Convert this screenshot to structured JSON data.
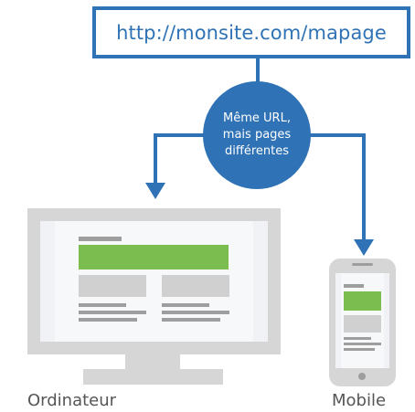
{
  "url": "http://monsite.com/mapage",
  "bubble": {
    "lines": [
      "Même URL,",
      "mais pages",
      "différentes"
    ]
  },
  "devices": {
    "desktop_label": "Ordinateur",
    "mobile_label": "Mobile"
  },
  "colors": {
    "accent_blue": "#2f73b6",
    "green_banner": "#7bbd4f",
    "device_frame": "#d6d6d6",
    "screen_bg": "#f0f2f5"
  }
}
